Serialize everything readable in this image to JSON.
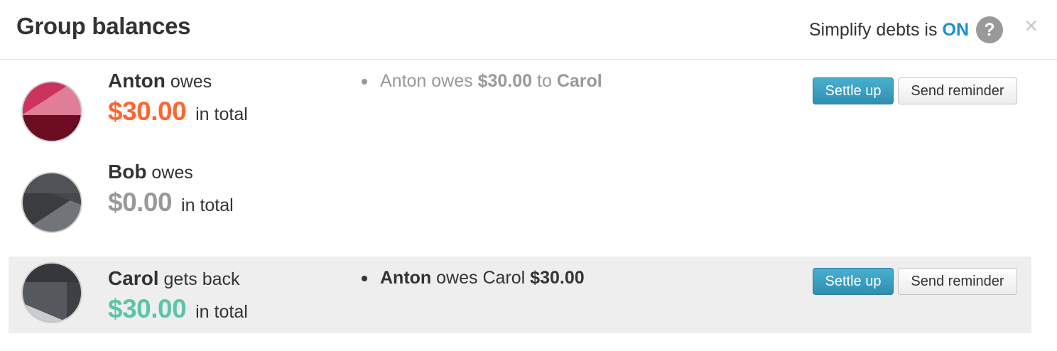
{
  "header": {
    "title": "Group balances",
    "simplify_label": "Simplify debts is",
    "simplify_state": "ON",
    "help_glyph": "?",
    "close_glyph": "×"
  },
  "balances": [
    {
      "name": "Anton",
      "verb": "owes",
      "amount": "$30.00",
      "suffix": "in total",
      "amount_status": "negative",
      "detail": {
        "pre": "Anton owes",
        "amount": "$30.00",
        "mid": "to",
        "name": "Carol"
      },
      "actions": {
        "settle": "Settle up",
        "remind": "Send reminder"
      }
    },
    {
      "name": "Bob",
      "verb": "owes",
      "amount": "$0.00",
      "suffix": "in total",
      "amount_status": "zero"
    },
    {
      "name": "Carol",
      "verb": "gets back",
      "amount": "$30.00",
      "suffix": "in total",
      "amount_status": "positive",
      "detail": {
        "name": "Anton",
        "mid": "owes Carol",
        "amount": "$30.00"
      },
      "actions": {
        "settle": "Settle up",
        "remind": "Send reminder"
      }
    }
  ],
  "colors": {
    "negative": "#ff652f",
    "zero": "#999999",
    "positive": "#5bc5a7",
    "accent": "#1a8fd1",
    "settle_button": "#3aa0c0"
  }
}
